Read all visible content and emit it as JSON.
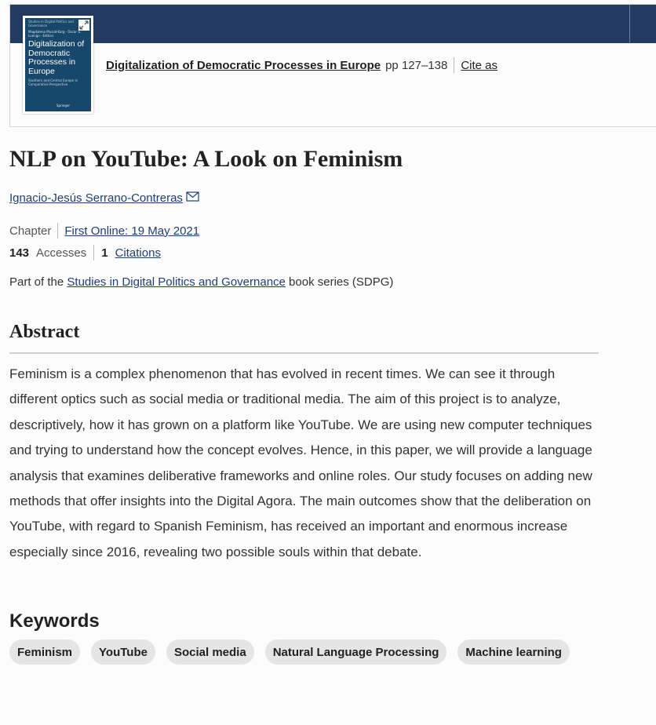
{
  "book": {
    "cover": {
      "series_label": "Studies in Digital Politics and Governance",
      "editors": "Magdalena Musiał-Karg · Óscar G. Luengo · Editors",
      "title": "Digitalization of Democratic Processes in Europe",
      "subtitle": "Southern and Central Europe in Comparative Perspective",
      "publisher": "Springer"
    },
    "title": "Digitalization of Democratic Processes in Europe",
    "pages": "pp 127–138",
    "cite_label": "Cite as"
  },
  "chapter": {
    "title": "NLP on YouTube: A Look on Feminism",
    "author": "Ignacio-Jesús Serrano-Contreras",
    "type": "Chapter",
    "first_online": "First Online: 19 May 2021",
    "accesses_count": "143",
    "accesses_label": "Accesses",
    "citations_count": "1",
    "citations_label": "Citations",
    "series_prefix": "Part of the",
    "series_name": "Studies in Digital Politics and Governance",
    "series_suffix": "book series (SDPG)"
  },
  "abstract": {
    "heading": "Abstract",
    "text": "Feminism is a complex phenomenon that has evolved in recent times. We can see it through different optics such as social media or traditional media. The aim of this project is to analyze, descriptively, how it has grown on a platform like YouTube. We are using new computer techniques and trying to understand how the concept evolves. Hence, in this paper, we will provide a language analysis that examines deliberative frameworks and online roles. Our study focuses on adding new methods that offer insights into the Digital Agora. The main outcomes show that the deliberation on YouTube, with regard to Spanish Feminism, has received an important and enormous increase especially since 2016, revealing two possible souls within that debate."
  },
  "keywords": {
    "heading": "Keywords",
    "items": [
      "Feminism",
      "YouTube",
      "Social media",
      "Natural Language Processing",
      "Machine learning"
    ]
  },
  "icons": {
    "expand": "expand-icon",
    "mail": "mail-icon"
  },
  "colors": {
    "header_band": "#233b63",
    "link": "#1f3f74",
    "keyword_pill": "#e5e5e5"
  }
}
